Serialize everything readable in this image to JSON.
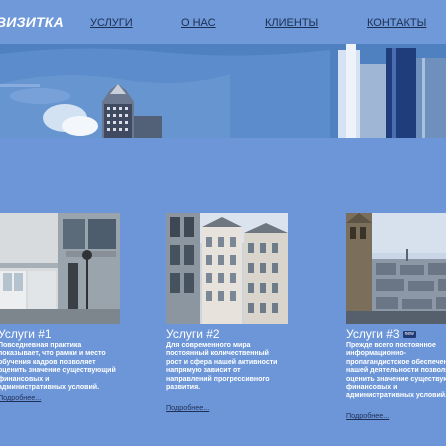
{
  "site": {
    "logo": "ВИЗИТКА"
  },
  "nav": [
    {
      "label": "УСЛУГИ"
    },
    {
      "label": "О НАС"
    },
    {
      "label": "КЛИЕНТЫ"
    },
    {
      "label": "КОНТАКТЫ"
    }
  ],
  "cards": [
    {
      "title": "Услуги #1",
      "text": "Повседневная практика показывает, что рамки и место обучения кадров позволяет оценить значение существующий финансовых и административных условий.",
      "more": "Подробнее..."
    },
    {
      "title": "Услуги #2",
      "text": "Для современного мира постоянный количественный рост и сфера нашей активности напрямую зависит от направлений прогрессивного развития.",
      "more": "Подробнее..."
    },
    {
      "title": "Услуги #3",
      "badge": "new",
      "text": "Прежде всего постоянное информационно-пропагандистское обеспечение нашей деятельности позволяет оценить значение существующий финансовых и административных условий.",
      "more": "Подробнее..."
    }
  ],
  "colors": {
    "page_bg": "#6a95d7",
    "nav_text": "#1c2f52",
    "title_text": "#ffffff",
    "link_text": "#1f2f55",
    "badge_bg": "#213a73"
  }
}
